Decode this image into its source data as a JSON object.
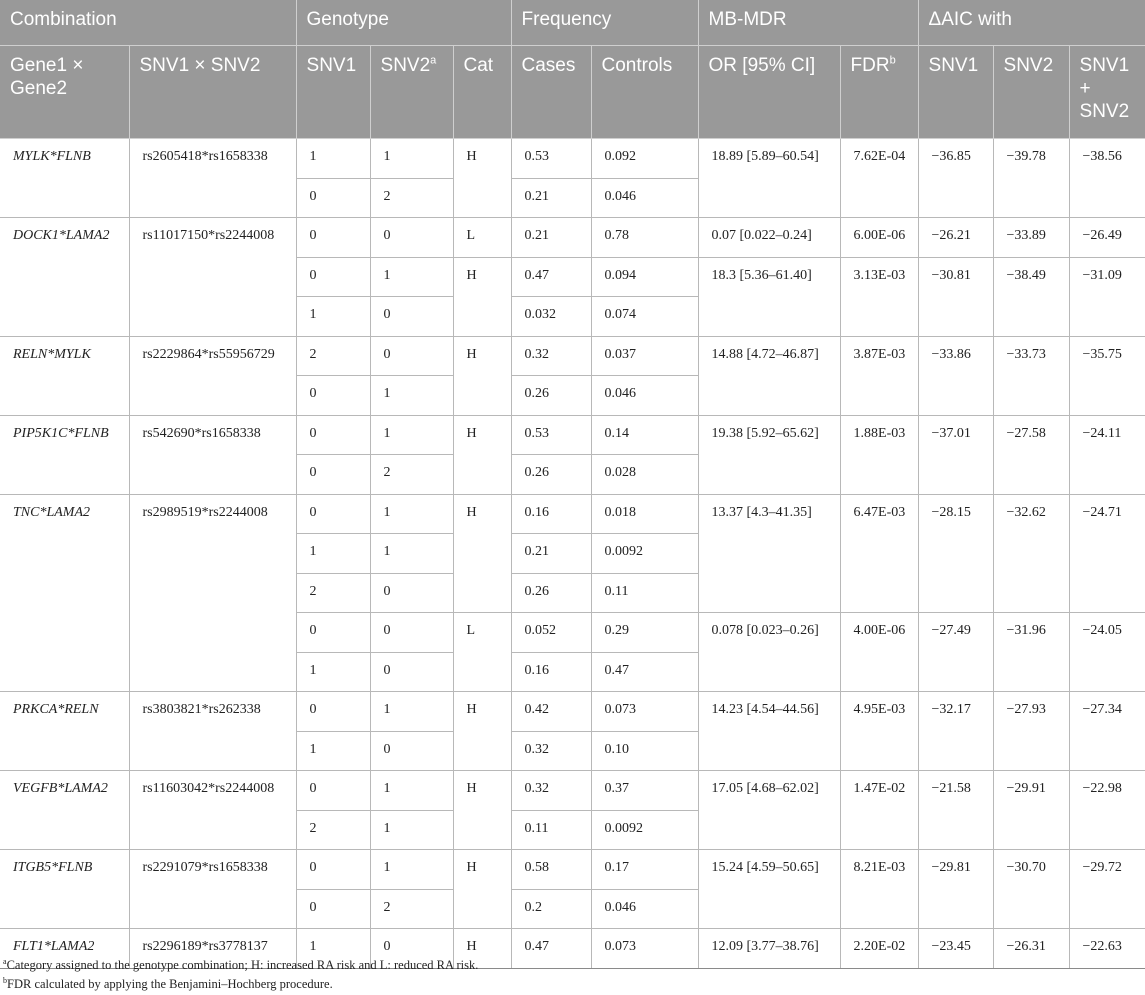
{
  "header": {
    "groups": [
      "Combination",
      "Genotype",
      "Frequency",
      "MB-MDR",
      "ΔAIC with"
    ],
    "columns": {
      "gene_pair": "Gene1 × Gene2",
      "snv_pair": "SNV1 × SNV2",
      "snv1": "SNV1",
      "snv2": "SNV2",
      "snv2_sup": "a",
      "cat": "Cat",
      "cases": "Cases",
      "controls": "Controls",
      "or": "OR [95% CI]",
      "fdr": "FDR",
      "fdr_sup": "b",
      "aic_snv1": "SNV1",
      "aic_snv2": "SNV2",
      "aic_both": "SNV1 + SNV2"
    }
  },
  "rows": [
    {
      "gene": "MYLK*FLNB",
      "snv": "rs2605418*rs1658338",
      "g1": "1",
      "g2": "1",
      "cat": "H",
      "cases": "0.53",
      "controls": "0.092",
      "or": "18.89 [5.89–60.54]",
      "fdr": "7.62E-04",
      "a1": "−36.85",
      "a2": "−39.78",
      "a3": "−38.56"
    },
    {
      "gene": "",
      "snv": "",
      "g1": "0",
      "g2": "2",
      "cat": "",
      "cases": "0.21",
      "controls": "0.046",
      "or": "",
      "fdr": "",
      "a1": "",
      "a2": "",
      "a3": ""
    },
    {
      "gene": "DOCK1*LAMA2",
      "snv": "rs11017150*rs2244008",
      "g1": "0",
      "g2": "0",
      "cat": "L",
      "cases": "0.21",
      "controls": "0.78",
      "or": "0.07 [0.022–0.24]",
      "fdr": "6.00E-06",
      "a1": "−26.21",
      "a2": "−33.89",
      "a3": "−26.49"
    },
    {
      "gene": "",
      "snv": "",
      "g1": "0",
      "g2": "1",
      "cat": "H",
      "cases": "0.47",
      "controls": "0.094",
      "or": "18.3 [5.36–61.40]",
      "fdr": "3.13E-03",
      "a1": "−30.81",
      "a2": "−38.49",
      "a3": "−31.09"
    },
    {
      "gene": "",
      "snv": "",
      "g1": "1",
      "g2": "0",
      "cat": "",
      "cases": "0.032",
      "controls": "0.074",
      "or": "",
      "fdr": "",
      "a1": "",
      "a2": "",
      "a3": ""
    },
    {
      "gene": "RELN*MYLK",
      "snv": "rs2229864*rs55956729",
      "g1": "2",
      "g2": "0",
      "cat": "H",
      "cases": "0.32",
      "controls": "0.037",
      "or": "14.88 [4.72–46.87]",
      "fdr": "3.87E-03",
      "a1": "−33.86",
      "a2": "−33.73",
      "a3": "−35.75"
    },
    {
      "gene": "",
      "snv": "",
      "g1": "0",
      "g2": "1",
      "cat": "",
      "cases": "0.26",
      "controls": "0.046",
      "or": "",
      "fdr": "",
      "a1": "",
      "a2": "",
      "a3": ""
    },
    {
      "gene": "PIP5K1C*FLNB",
      "snv": "rs542690*rs1658338",
      "g1": "0",
      "g2": "1",
      "cat": "H",
      "cases": "0.53",
      "controls": "0.14",
      "or": "19.38 [5.92–65.62]",
      "fdr": "1.88E-03",
      "a1": "−37.01",
      "a2": "−27.58",
      "a3": "−24.11"
    },
    {
      "gene": "",
      "snv": "",
      "g1": "0",
      "g2": "2",
      "cat": "",
      "cases": "0.26",
      "controls": "0.028",
      "or": "",
      "fdr": "",
      "a1": "",
      "a2": "",
      "a3": ""
    },
    {
      "gene": "TNC*LAMA2",
      "snv": "rs2989519*rs2244008",
      "g1": "0",
      "g2": "1",
      "cat": "H",
      "cases": "0.16",
      "controls": "0.018",
      "or": "13.37 [4.3–41.35]",
      "fdr": "6.47E-03",
      "a1": "−28.15",
      "a2": "−32.62",
      "a3": "−24.71"
    },
    {
      "gene": "",
      "snv": "",
      "g1": "1",
      "g2": "1",
      "cat": "",
      "cases": "0.21",
      "controls": "0.0092",
      "or": "",
      "fdr": "",
      "a1": "",
      "a2": "",
      "a3": ""
    },
    {
      "gene": "",
      "snv": "",
      "g1": "2",
      "g2": "0",
      "cat": "",
      "cases": "0.26",
      "controls": "0.11",
      "or": "",
      "fdr": "",
      "a1": "",
      "a2": "",
      "a3": ""
    },
    {
      "gene": "",
      "snv": "",
      "g1": "0",
      "g2": "0",
      "cat": "L",
      "cases": "0.052",
      "controls": "0.29",
      "or": "0.078 [0.023–0.26]",
      "fdr": "4.00E-06",
      "a1": "−27.49",
      "a2": "−31.96",
      "a3": "−24.05"
    },
    {
      "gene": "",
      "snv": "",
      "g1": "1",
      "g2": "0",
      "cat": "",
      "cases": "0.16",
      "controls": "0.47",
      "or": "",
      "fdr": "",
      "a1": "",
      "a2": "",
      "a3": ""
    },
    {
      "gene": "PRKCA*RELN",
      "snv": "rs3803821*rs262338",
      "g1": "0",
      "g2": "1",
      "cat": "H",
      "cases": "0.42",
      "controls": "0.073",
      "or": "14.23 [4.54–44.56]",
      "fdr": "4.95E-03",
      "a1": "−32.17",
      "a2": "−27.93",
      "a3": "−27.34"
    },
    {
      "gene": "",
      "snv": "",
      "g1": "1",
      "g2": "0",
      "cat": "",
      "cases": "0.32",
      "controls": "0.10",
      "or": "",
      "fdr": "",
      "a1": "",
      "a2": "",
      "a3": ""
    },
    {
      "gene": "VEGFB*LAMA2",
      "snv": "rs11603042*rs2244008",
      "g1": "0",
      "g2": "1",
      "cat": "H",
      "cases": "0.32",
      "controls": "0.37",
      "or": "17.05 [4.68–62.02]",
      "fdr": "1.47E-02",
      "a1": "−21.58",
      "a2": "−29.91",
      "a3": "−22.98"
    },
    {
      "gene": "",
      "snv": "",
      "g1": "2",
      "g2": "1",
      "cat": "",
      "cases": "0.11",
      "controls": "0.0092",
      "or": "",
      "fdr": "",
      "a1": "",
      "a2": "",
      "a3": ""
    },
    {
      "gene": "ITGB5*FLNB",
      "snv": "rs2291079*rs1658338",
      "g1": "0",
      "g2": "1",
      "cat": "H",
      "cases": "0.58",
      "controls": "0.17",
      "or": "15.24 [4.59–50.65]",
      "fdr": "8.21E-03",
      "a1": "−29.81",
      "a2": "−30.70",
      "a3": "−29.72"
    },
    {
      "gene": "",
      "snv": "",
      "g1": "0",
      "g2": "2",
      "cat": "",
      "cases": "0.2",
      "controls": "0.046",
      "or": "",
      "fdr": "",
      "a1": "",
      "a2": "",
      "a3": ""
    },
    {
      "gene": "FLT1*LAMA2",
      "snv": "rs2296189*rs3778137",
      "g1": "1",
      "g2": "0",
      "cat": "H",
      "cases": "0.47",
      "controls": "0.073",
      "or": "12.09 [3.77–38.76]",
      "fdr": "2.20E-02",
      "a1": "−23.45",
      "a2": "−26.31",
      "a3": "−22.63"
    }
  ],
  "footnotes": [
    {
      "mark": "a",
      "text": "Category assigned to the genotype combination; H: increased RA risk and L: reduced RA risk."
    },
    {
      "mark": "b",
      "text": "FDR calculated by applying the Benjamini–Hochberg procedure."
    }
  ]
}
